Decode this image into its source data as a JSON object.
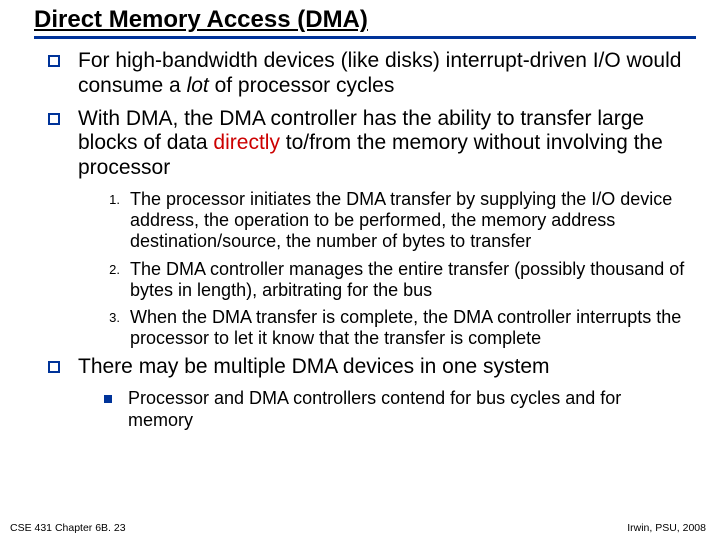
{
  "title": "Direct Memory Access (DMA)",
  "bullets": {
    "b1": {
      "pre": "For high-bandwidth devices (like disks) interrupt-driven I/O would consume a ",
      "italic": "lot",
      "post": " of processor cycles"
    },
    "b2": {
      "pre": "With DMA, the DMA controller has the ability to transfer large blocks of data ",
      "red": "directly",
      "post": " to/from the memory without involving the processor"
    },
    "b3": "There may be multiple DMA devices in one system"
  },
  "numbered": {
    "n1": {
      "num": "1.",
      "text": "The processor initiates the DMA transfer by supplying the I/O device address, the operation to be performed, the memory address destination/source, the number of bytes to transfer"
    },
    "n2": {
      "num": "2.",
      "text": "The DMA controller manages the entire transfer (possibly thousand of bytes in length), arbitrating for the bus"
    },
    "n3": {
      "num": "3.",
      "text": "When the DMA transfer is complete, the DMA controller interrupts the processor to let it know that the transfer is complete"
    }
  },
  "sub": {
    "s1": "Processor and DMA controllers contend for bus cycles and for memory"
  },
  "footer": {
    "left": "CSE 431  Chapter 6B. 23",
    "right": "Irwin, PSU, 2008"
  }
}
